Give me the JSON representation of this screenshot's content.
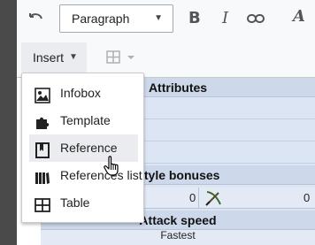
{
  "toolbar": {
    "paragraph_label": "Paragraph",
    "bold_label": "B",
    "italic_label": "I",
    "textstyle_label": "A",
    "insert_label": "Insert"
  },
  "insert_menu": {
    "items": [
      {
        "label": "Infobox",
        "icon": "infobox-icon"
      },
      {
        "label": "Template",
        "icon": "puzzle-icon"
      },
      {
        "label": "Reference",
        "icon": "bookmark-icon"
      },
      {
        "label": "References list",
        "icon": "references-icon"
      },
      {
        "label": "Table",
        "icon": "table-icon"
      }
    ],
    "hovered_item": "Reference"
  },
  "content_table": {
    "attributes_header": "Attributes",
    "style_bonuses_header": "Style bonuses",
    "attack_speed_header": "Attack speed",
    "style_values": [
      "0",
      "0"
    ],
    "attack_speed_value": "Fastest"
  },
  "colors": {
    "toolbar_bg": "#f8f9fa",
    "menu_hover_bg": "#eaecf0",
    "table_header_bg": "#cdd8ea",
    "table_bg": "#dce5f3",
    "icon_color": "#222222"
  }
}
